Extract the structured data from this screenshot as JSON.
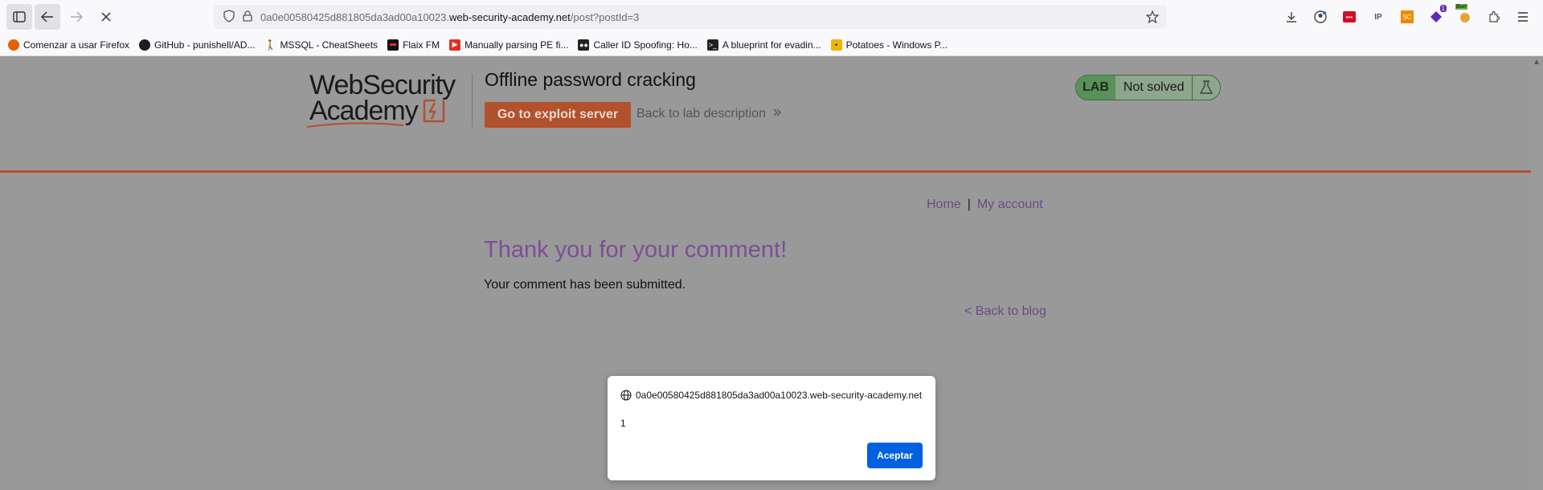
{
  "browser": {
    "url_prefix": "0a0e00580425d881805da3ad00a10023.",
    "url_domain": "web-security-academy.net",
    "url_path": "/post?postId=3",
    "bookmarks": [
      {
        "label": "Comenzar a usar Firefox",
        "color": "#e66000"
      },
      {
        "label": "GitHub - punishell/AD...",
        "color": "#1b1f23"
      },
      {
        "label": "MSSQL - CheatSheets",
        "color": "#555555"
      },
      {
        "label": "Flaix FM",
        "color": "#111111"
      },
      {
        "label": "Manually parsing PE fi...",
        "color": "#e52d27"
      },
      {
        "label": "Caller ID Spoofing: Ho...",
        "color": "#222222"
      },
      {
        "label": "A blueprint for evadin...",
        "color": "#222222"
      },
      {
        "label": "Potatoes - Windows P...",
        "color": "#f0b400"
      }
    ],
    "extension_badge": "1",
    "ext_bur": "Burr"
  },
  "lab": {
    "logo_line1": "WebSecurity",
    "logo_line2": "Academy",
    "title": "Offline password cracking",
    "exploit_button": "Go to exploit server",
    "back_to_description": "Back to lab description",
    "badge_lab": "LAB",
    "badge_status": "Not solved"
  },
  "nav": {
    "home": "Home",
    "separator": "|",
    "my_account": "My account"
  },
  "content": {
    "heading": "Thank you for your comment!",
    "message": "Your comment has been submitted.",
    "back_to_blog": "< Back to blog"
  },
  "dialog": {
    "origin": "0a0e00580425d881805da3ad00a10023.web-security-academy.net",
    "message": "1",
    "accept_button": "Aceptar"
  }
}
